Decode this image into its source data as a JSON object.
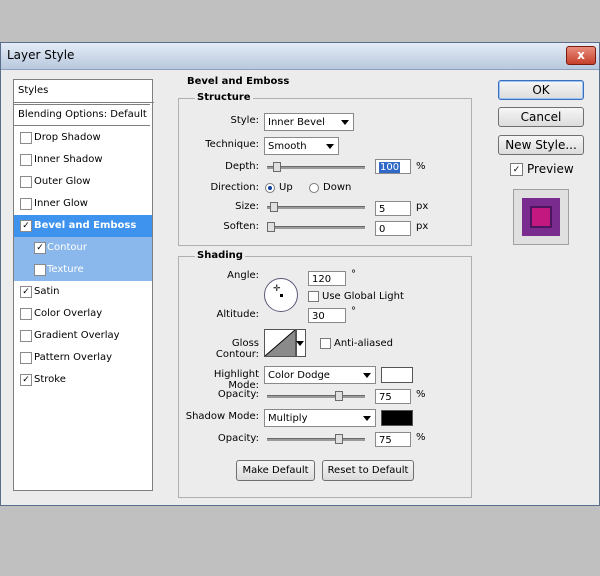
{
  "window": {
    "title": "Layer Style",
    "close": "x"
  },
  "styles_panel": {
    "header": "Styles",
    "blending": "Blending Options: Default",
    "items": [
      {
        "label": "Drop Shadow",
        "checked": false
      },
      {
        "label": "Inner Shadow",
        "checked": false
      },
      {
        "label": "Outer Glow",
        "checked": false
      },
      {
        "label": "Inner Glow",
        "checked": false
      },
      {
        "label": "Bevel and Emboss",
        "checked": true,
        "selected": true
      },
      {
        "label": "Contour",
        "checked": true,
        "sub": true
      },
      {
        "label": "Texture",
        "checked": false,
        "sub": true
      },
      {
        "label": "Satin",
        "checked": true
      },
      {
        "label": "Color Overlay",
        "checked": false
      },
      {
        "label": "Gradient Overlay",
        "checked": false
      },
      {
        "label": "Pattern Overlay",
        "checked": false
      },
      {
        "label": "Stroke",
        "checked": true
      }
    ]
  },
  "bevel": {
    "section_title": "Bevel and Emboss",
    "structure": {
      "title": "Structure",
      "style_label": "Style:",
      "style_value": "Inner Bevel",
      "technique_label": "Technique:",
      "technique_value": "Smooth",
      "depth_label": "Depth:",
      "depth_value": "100",
      "depth_unit": "%",
      "depth_level": 0.07,
      "direction_label": "Direction:",
      "direction_up": "Up",
      "direction_down": "Down",
      "size_label": "Size:",
      "size_value": "5",
      "size_unit": "px",
      "size_level": 0.03,
      "soften_label": "Soften:",
      "soften_value": "0",
      "soften_unit": "px",
      "soften_level": 0.0
    },
    "shading": {
      "title": "Shading",
      "angle_label": "Angle:",
      "angle_value": "120",
      "angle_unit": "°",
      "global_light_label": "Use Global Light",
      "altitude_label": "Altitude:",
      "altitude_value": "30",
      "altitude_unit": "°",
      "gloss_label": "Gloss Contour:",
      "antialiased_label": "Anti-aliased",
      "highlight_label": "Highlight Mode:",
      "highlight_value": "Color Dodge",
      "highlight_color": "#ffffff",
      "opacity_label": "Opacity:",
      "highlight_opacity": "75",
      "opacity_unit": "%",
      "highlight_level": 0.75,
      "shadow_label": "Shadow Mode:",
      "shadow_value": "Multiply",
      "shadow_color": "#000000",
      "shadow_opacity_label": "Opacity:",
      "shadow_opacity": "75",
      "shadow_level": 0.75
    },
    "make_default": "Make Default",
    "reset_default": "Reset to Default"
  },
  "buttons": {
    "ok": "OK",
    "cancel": "Cancel",
    "new_style": "New Style...",
    "preview": "Preview"
  },
  "preview_colors": {
    "outer": "#7a2b8e",
    "inner": "#c2187f"
  }
}
